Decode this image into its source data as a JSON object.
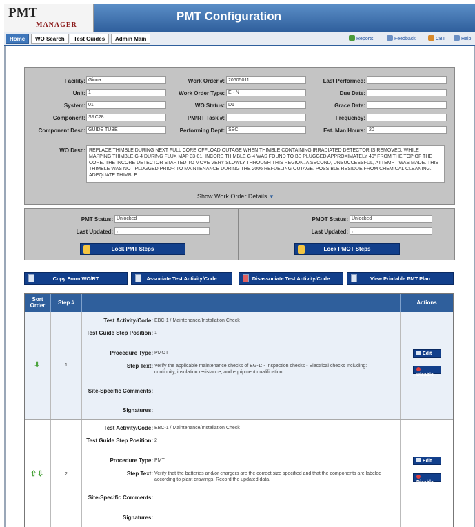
{
  "header": {
    "logo_main": "PMT",
    "logo_sub": "MANAGER",
    "title": "PMT Configuration"
  },
  "nav": {
    "tabs": [
      "Home",
      "WO Search",
      "Test Guides",
      "Admin Main"
    ],
    "links": [
      "Reports",
      "Feedback",
      "CBT",
      "Help"
    ]
  },
  "workorder": {
    "facility_label": "Facility:",
    "facility": "Ginna",
    "unit_label": "Unit:",
    "unit": "1",
    "system_label": "System:",
    "system": "01",
    "component_label": "Component:",
    "component": "SRC28",
    "component_desc_label": "Component Desc:",
    "component_desc": "GUIDE TUBE",
    "wo_number_label": "Work Order #:",
    "wo_number": "20605011",
    "wo_type_label": "Work Order Type:",
    "wo_type": "E - N",
    "wo_status_label": "WO Status:",
    "wo_status": "D1",
    "pmrt_label": "PM/RT Task #:",
    "pmrt": "",
    "perf_dept_label": "Performing Dept:",
    "perf_dept": "SEC",
    "last_performed_label": "Last Performed:",
    "last_performed": "",
    "due_date_label": "Due Date:",
    "due_date": "",
    "grace_date_label": "Grace Date:",
    "grace_date": "",
    "frequency_label": "Frequency:",
    "frequency": "",
    "est_hours_label": "Est. Man Hours:",
    "est_hours": "20",
    "wo_desc_label": "WO Desc:",
    "wo_desc": "REPLACE THIMBLE DURING NEXT FULL CORE OFFLOAD OUTAGE WHEN THIMBLE CONTAINING IRRADIATED DETECTOR IS REMOVED. WHILE MAPPING THIMBLE G-4 DURING FLUX MAP 33-01, INCORE THIMBLE G-4 WAS FOUND TO BE PLUGGED APPROXIMATELY 40\" FROM THE TOP OF THE CORE. THE INCORE DETECTOR STARTED TO MOVE VERY SLOWLY THROUGH THIS REGION. A SECOND, UNSUCCESSFUL, ATTEMPT WAS MADE. THIS THIMBLE WAS NOT PLUGGED PRIOR TO MAINTENANCE DURING THE 2006 REFUELING OUTAGE. POSSIBLE RESIDUE FROM CHEMICAL CLEANING. ADEQUATE THIMBLE",
    "show_details": "Show Work Order Details"
  },
  "pmt": {
    "status_label": "PMT Status:",
    "status": "Unlocked",
    "updated_label": "Last Updated:",
    "updated": ",",
    "lock_button": "Lock PMT Steps"
  },
  "pmot": {
    "status_label": "PMOT Status:",
    "status": "Unlocked",
    "updated_label": "Last Updated:",
    "updated": ",",
    "lock_button": "Lock PMOT Steps"
  },
  "actions": [
    "Copy From WO/RT",
    "Associate Test Activity/Code",
    "Disassociate Test Activity/Code",
    "View Printable PMT Plan"
  ],
  "table": {
    "headers": {
      "sort": "Sort Order",
      "step": "Step #",
      "actions": "Actions"
    },
    "field_labels": {
      "activity": "Test Activity/Code:",
      "guide_step": "Test Guide Step Position:",
      "procedure": "Procedure Type:",
      "step_text": "Step Text:",
      "comments": "Site-Specific Comments:",
      "signatures": "Signatures:"
    },
    "edit_label": "Edit",
    "disable_label": "Disable",
    "rows": [
      {
        "step": "1",
        "activity": "EBC-1 / Maintenance/Installation Check",
        "guide_step": "1",
        "procedure": "PMOT",
        "step_text": "Verify the applicable maintenance checks of EG-1: - Inspection checks - Electrical checks including: continuity, insulation resistance, and equipment qualification",
        "comments": "",
        "signatures": ""
      },
      {
        "step": "2",
        "activity": "EBC-1 / Maintenance/Installation Check",
        "guide_step": "2",
        "procedure": "PMT",
        "step_text": "Verify that the batteries and/or chargers are the correct size specified and that the components are labeled according to plant drawings. Record the updated data.",
        "comments": "",
        "signatures": ""
      }
    ]
  }
}
